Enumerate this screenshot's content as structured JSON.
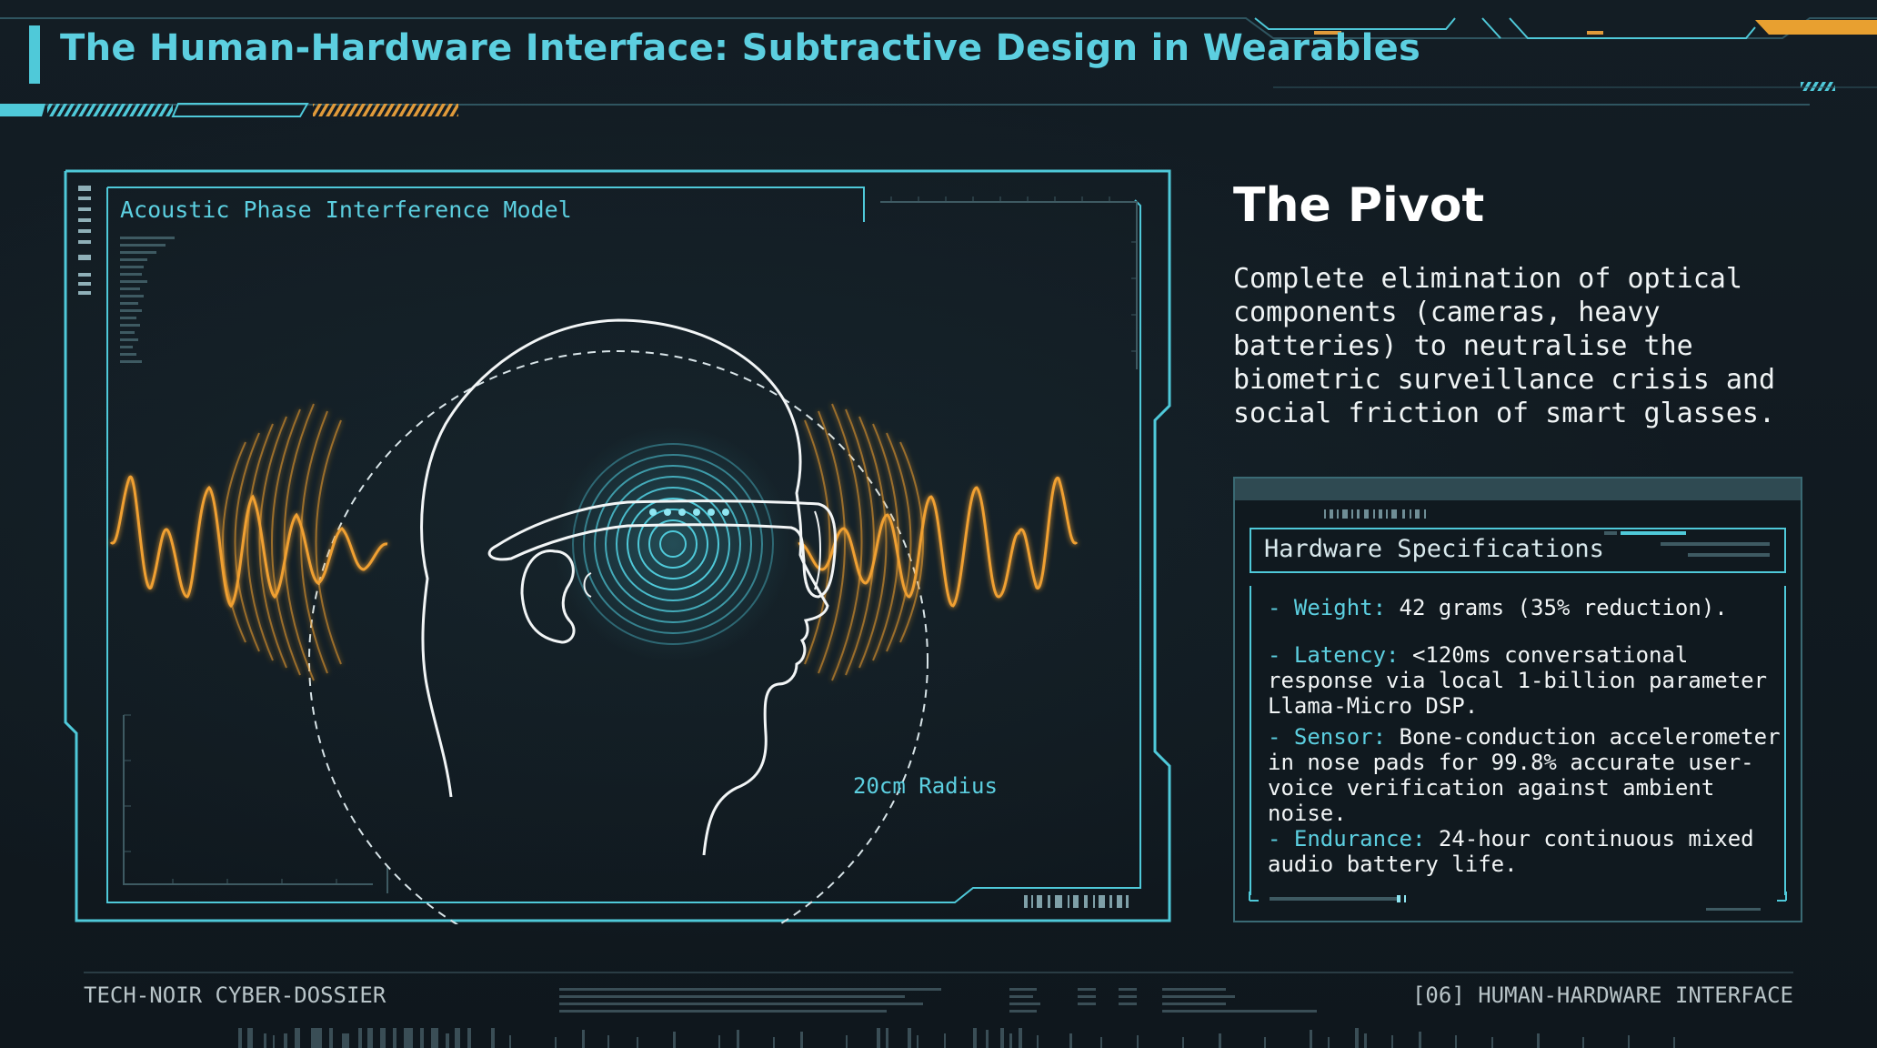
{
  "header": {
    "title": "The Human-Hardware Interface: Subtractive Design in Wearables"
  },
  "diagram": {
    "title": "Acoustic Phase Interference Model",
    "radius_label": "20cm Radius"
  },
  "pivot": {
    "heading": "The Pivot",
    "body": "Complete elimination of optical components (cameras, heavy batteries) to neutralise the biometric surveillance crisis and social friction of smart glasses."
  },
  "specs": {
    "title": "Hardware Specifications",
    "items": [
      {
        "key": "- Weight:",
        "value": " 42 grams (35% reduction)."
      },
      {
        "key": "- Latency:",
        "value": " <120ms conversational response via local 1-billion parameter Llama-Micro DSP."
      },
      {
        "key": "- Sensor:",
        "value": " Bone-conduction accelerometer in nose pads for 99.8% accurate user-voice verification against ambient noise."
      },
      {
        "key": "- Endurance:",
        "value": " 24-hour continuous mixed audio battery life."
      }
    ]
  },
  "footer": {
    "left": "TECH-NOIR CYBER-DOSSIER",
    "right": "[06] HUMAN-HARDWARE INTERFACE"
  },
  "colors": {
    "accent": "#4fc9d9",
    "wave": "#f0a030",
    "background": "#111a20"
  }
}
